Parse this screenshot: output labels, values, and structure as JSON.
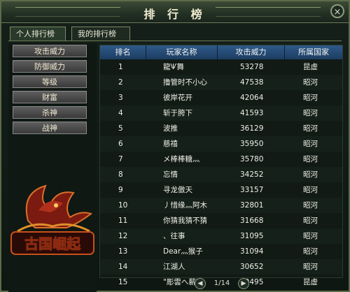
{
  "window": {
    "title": "排 行 榜",
    "close_icon": "×"
  },
  "tabs": [
    {
      "label": "个人排行榜"
    },
    {
      "label": "我的排行榜"
    }
  ],
  "categories": [
    {
      "label": "攻击威力"
    },
    {
      "label": "防御威力"
    },
    {
      "label": "等级"
    },
    {
      "label": "财富"
    },
    {
      "label": "杀神"
    },
    {
      "label": "战神"
    }
  ],
  "logo": {
    "text": "古国崛起"
  },
  "table": {
    "headers": {
      "rank": "排名",
      "name": "玩家名称",
      "power": "攻击威力",
      "country": "所属国家"
    },
    "rows": [
      {
        "rank": "1",
        "name": "龍Ѱ舞",
        "power": "53278",
        "country": "昆虚"
      },
      {
        "rank": "2",
        "name": "撸管时不小心",
        "power": "47538",
        "country": "昭河"
      },
      {
        "rank": "3",
        "name": "彼岸花开",
        "power": "42064",
        "country": "昭河"
      },
      {
        "rank": "4",
        "name": "斩于胯下",
        "power": "41593",
        "country": "昭河"
      },
      {
        "rank": "5",
        "name": "波推",
        "power": "36129",
        "country": "昭河"
      },
      {
        "rank": "6",
        "name": "慈禧",
        "power": "35950",
        "country": "昭河"
      },
      {
        "rank": "7",
        "name": "メ棒棒糖灬",
        "power": "35780",
        "country": "昭河"
      },
      {
        "rank": "8",
        "name": "忘情",
        "power": "34252",
        "country": "昭河"
      },
      {
        "rank": "9",
        "name": "寻龙傲天",
        "power": "33157",
        "country": "昭河"
      },
      {
        "rank": "10",
        "name": "丿惜缘灬阿木",
        "power": "32801",
        "country": "昭河"
      },
      {
        "rank": "11",
        "name": "你猜我猜不猜",
        "power": "31668",
        "country": "昭河"
      },
      {
        "rank": "12",
        "name": "、往事",
        "power": "31095",
        "country": "昭河"
      },
      {
        "rank": "13",
        "name": "Dear灬猴子",
        "power": "31094",
        "country": "昭河"
      },
      {
        "rank": "14",
        "name": "江湖人",
        "power": "30652",
        "country": "昭河"
      },
      {
        "rank": "15",
        "name": "\"彫雲へ薪\"",
        "power": "30495",
        "country": "昆虚"
      }
    ]
  },
  "pager": {
    "text": "1/14",
    "prev_icon": "◀",
    "next_icon": "▶"
  },
  "colors": {
    "header_blue": "#2e5a88",
    "frame": "#6b7a55"
  }
}
